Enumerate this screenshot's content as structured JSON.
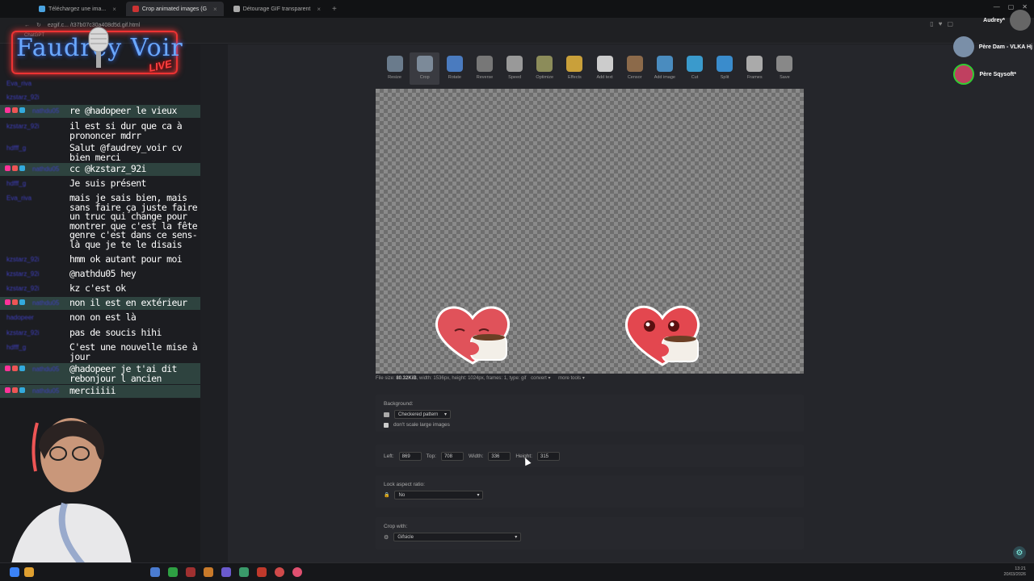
{
  "browser": {
    "tabs": [
      {
        "label": "Téléchargez une ima...",
        "active": false
      },
      {
        "label": "Crop animated images (G",
        "active": true
      },
      {
        "label": "Détourage GIF transparent",
        "active": false
      }
    ],
    "url_partial": "ezgif.c...  /t37b07c30a408d5d.gif.html",
    "bookmark_chatgpt": "ChatGPT"
  },
  "overlay": {
    "logo_text": "Faudrey Voir",
    "logo_live": "LIVE"
  },
  "chat": [
    {
      "user": "Eva_riva",
      "text": "",
      "hl": false
    },
    {
      "user": "kzstarz_92i",
      "text": "",
      "hl": false
    },
    {
      "user": "nathdu05",
      "text": "re @hadopeer le vieux",
      "hl": true
    },
    {
      "user": "kzstarz_92i",
      "text": "il est si dur que ca à prononcer mdrr",
      "hl": false
    },
    {
      "user": "hdfff_g",
      "text": "Salut @faudrey_voir cv bien merci",
      "hl": false
    },
    {
      "user": "nathdu05",
      "text": "cc @kzstarz_92i",
      "hl": true
    },
    {
      "user": "hdfff_g",
      "text": "Je suis présent",
      "hl": false
    },
    {
      "user": "Eva_riva",
      "text": "mais je sais bien, mais sans faire ça juste faire un truc qui change pour montrer que c'est la fête genre c'est dans ce sens-là que je te le disais",
      "hl": false
    },
    {
      "user": "kzstarz_92i",
      "text": "hmm ok autant pour moi",
      "hl": false
    },
    {
      "user": "kzstarz_92i",
      "text": "@nathdu05 hey",
      "hl": false
    },
    {
      "user": "kzstarz_92i",
      "text": "kz c'est ok",
      "hl": false
    },
    {
      "user": "nathdu05",
      "text": "non il est en extérieur",
      "hl": true
    },
    {
      "user": "hadopeer",
      "text": "non on est là",
      "hl": false
    },
    {
      "user": "kzstarz_92i",
      "text": "pas de soucis hihi",
      "hl": false
    },
    {
      "user": "hdfff_g",
      "text": "C'est une nouvelle mise à jour",
      "hl": false
    },
    {
      "user": "nathdu05",
      "text": "@hadopeer je t'ai dit rebonjour l ancien",
      "hl": true
    },
    {
      "user": "nathdu05",
      "text": "merciiiii",
      "hl": true
    }
  ],
  "toolbar": {
    "tools": [
      {
        "label": "Resize",
        "icon": "resize-icon",
        "color": "#6a7b8c"
      },
      {
        "label": "Crop",
        "icon": "crop-icon",
        "color": "#7c8a99"
      },
      {
        "label": "Rotate",
        "icon": "rotate-icon",
        "color": "#4a7bbf"
      },
      {
        "label": "Reverse",
        "icon": "reverse-icon",
        "color": "#777777"
      },
      {
        "label": "Speed",
        "icon": "speed-icon",
        "color": "#999999"
      },
      {
        "label": "Optimize",
        "icon": "optimize-icon",
        "color": "#8c8c5a"
      },
      {
        "label": "Effects",
        "icon": "effects-icon",
        "color": "#c9a03a"
      },
      {
        "label": "Add text",
        "icon": "add-text-icon",
        "color": "#cccccc"
      },
      {
        "label": "Censor",
        "icon": "censor-icon",
        "color": "#8c6a4a"
      },
      {
        "label": "Add image",
        "icon": "add-image-icon",
        "color": "#4a8cbf"
      },
      {
        "label": "Cut",
        "icon": "cut-icon",
        "color": "#3a9acc"
      },
      {
        "label": "Split",
        "icon": "split-icon",
        "color": "#3a8ccc"
      },
      {
        "label": "Frames",
        "icon": "frames-icon",
        "color": "#aaaaaa"
      },
      {
        "label": "Save",
        "icon": "save-icon",
        "color": "#888888"
      }
    ]
  },
  "fileinfo": {
    "prefix": "File size: ",
    "size": "80.32KiB",
    "details": ", width: 1536px, height: 1024px, frames: 1, type: gif",
    "convert": "convert ▾",
    "more_tools": "more tools ▾"
  },
  "background": {
    "title": "Background:",
    "select": "Checkered pattern",
    "dont_scale": "don't scale large images"
  },
  "crop": {
    "left_label": "Left:",
    "left": "869",
    "top_label": "Top:",
    "top": "708",
    "width_label": "Width:",
    "width": "336",
    "height_label": "Height:",
    "height": "315"
  },
  "aspect": {
    "title": "Lock aspect ratio:",
    "select": "No"
  },
  "cropwith": {
    "title": "Crop with:",
    "select": "Gifsicle"
  },
  "voice": [
    {
      "name": "Audrey*"
    },
    {
      "name": "Père Dam - VLKA Hj"
    },
    {
      "name": "Père Sqysoft*"
    }
  ],
  "clock": {
    "time": "13:21",
    "date": "20/03/2026"
  }
}
